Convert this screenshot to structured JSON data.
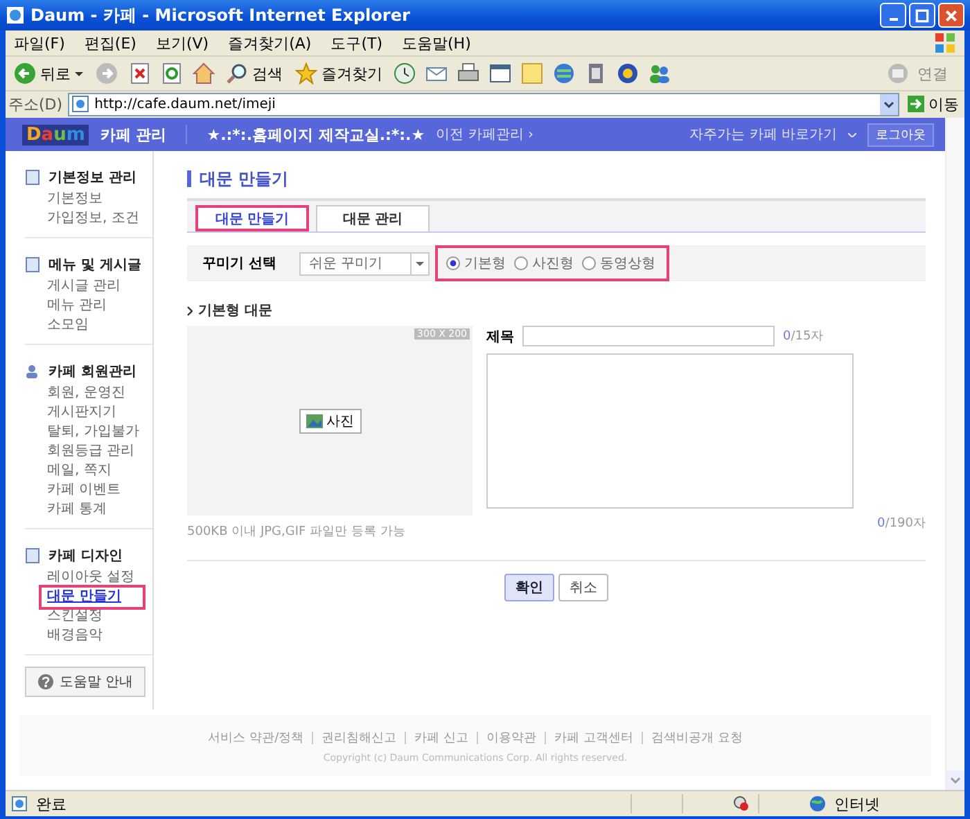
{
  "window": {
    "title": "Daum - 카페 - Microsoft Internet Explorer"
  },
  "menu": [
    "파일(F)",
    "편집(E)",
    "보기(V)",
    "즐겨찾기(A)",
    "도구(T)",
    "도움말(H)"
  ],
  "toolbar": {
    "back": "뒤로",
    "search": "검색",
    "favorites": "즐겨찾기",
    "connect": "연결"
  },
  "address": {
    "label": "주소(D)",
    "url": "http://cafe.daum.net/imeji",
    "go": "이동"
  },
  "cafe_header": {
    "logo": "Daum",
    "title": "카페 관리",
    "cafe_name": "★.:*:.홈페이지 제작교실.:*:.★",
    "previous": "이전 카페관리 ›",
    "shortcut": "자주가는 카페 바로가기",
    "logout": "로그아웃"
  },
  "sidebar": {
    "groups": [
      {
        "title": "기본정보 관리",
        "items": [
          {
            "label": "기본정보",
            "selected": false
          },
          {
            "label": "가입정보, 조건",
            "selected": false
          }
        ]
      },
      {
        "title": "메뉴 및 게시글",
        "items": [
          {
            "label": "게시글 관리",
            "selected": false
          },
          {
            "label": "메뉴 관리",
            "selected": false
          },
          {
            "label": "소모임",
            "selected": false
          }
        ]
      },
      {
        "title": "카페 회원관리",
        "items": [
          {
            "label": "회원, 운영진",
            "selected": false
          },
          {
            "label": "게시판지기",
            "selected": false
          },
          {
            "label": "탈퇴, 가입불가",
            "selected": false
          },
          {
            "label": "회원등급 관리",
            "selected": false
          },
          {
            "label": "메일, 쪽지",
            "selected": false
          },
          {
            "label": "카페 이벤트",
            "selected": false
          },
          {
            "label": "카페 통계",
            "selected": false
          }
        ]
      },
      {
        "title": "카페 디자인",
        "items": [
          {
            "label": "레이아웃 설정",
            "selected": false
          },
          {
            "label": "대문 만들기",
            "selected": true
          },
          {
            "label": "스킨설정",
            "selected": false
          },
          {
            "label": "배경음악",
            "selected": false
          }
        ]
      }
    ],
    "help": "도움말 안내"
  },
  "main": {
    "heading": "대문 만들기",
    "tabs": [
      {
        "label": "대문 만들기",
        "selected": true
      },
      {
        "label": "대문 관리",
        "selected": false
      }
    ],
    "decorate": {
      "label": "꾸미기 선택",
      "select": "쉬운 꾸미기",
      "highlighted": true,
      "options": [
        {
          "label": "기본형",
          "selected": true
        },
        {
          "label": "사진형",
          "selected": false
        },
        {
          "label": "동영상형",
          "selected": false
        }
      ]
    },
    "section": "기본형 대문",
    "image": {
      "size": "300 X 200",
      "button": "사진",
      "note": "500KB 이내 JPG,GIF 파일만 등록 가능"
    },
    "title_field": {
      "label": "제목",
      "count": "0",
      "limit": "/15자"
    },
    "body_field": {
      "count": "0",
      "limit": "/190자"
    },
    "buttons": [
      {
        "label": "확인",
        "primary": true
      },
      {
        "label": "취소",
        "primary": false
      }
    ]
  },
  "footer": {
    "links": [
      "서비스 약관/정책",
      "권리침해신고",
      "카페 신고",
      "이용약관",
      "카페 고객센터",
      "검색비공개 요청"
    ],
    "copyright": "Copyright (c) Daum Communications Corp. All rights reserved."
  },
  "status": {
    "text": "완료",
    "zone": "인터넷"
  }
}
